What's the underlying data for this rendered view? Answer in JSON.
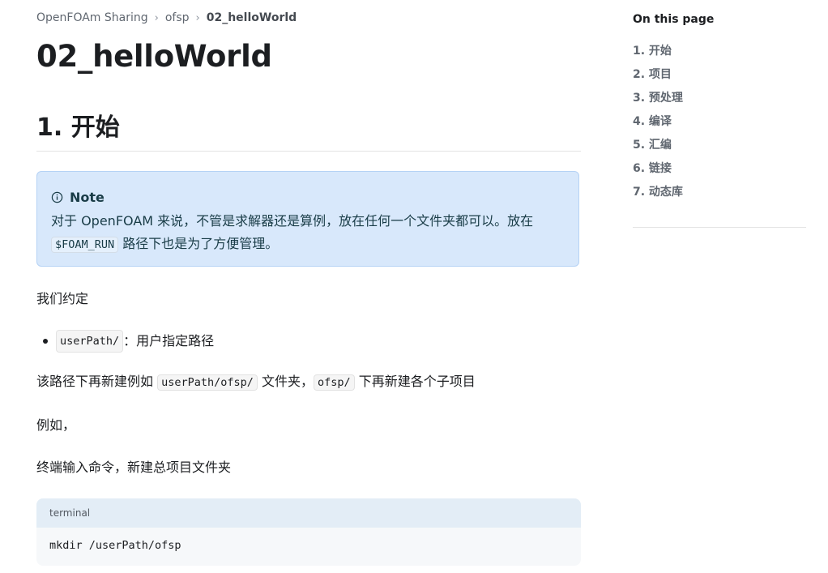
{
  "breadcrumbs": {
    "items": [
      "OpenFOAm Sharing",
      "ofsp"
    ],
    "current": "02_helloWorld"
  },
  "page": {
    "title": "02_helloWorld"
  },
  "section": {
    "heading": "1. 开始"
  },
  "note": {
    "label": "Note",
    "text_1": "对于 OpenFOAM 来说，不管是求解器还是算例，放在任何一个文件夹都可以。放在",
    "code": "$FOAM_RUN",
    "text_2": " 路径下也是为了方便管理。"
  },
  "content": {
    "convention": "我们约定",
    "bullet_code": "userPath/",
    "bullet_text": "：用户指定路径",
    "para2_a": "该路径下再新建例如 ",
    "para2_code1": "userPath/ofsp/",
    "para2_b": " 文件夹，",
    "para2_code2": "ofsp/",
    "para2_c": " 下再新建各个子项目",
    "example": "例如，",
    "terminal_instruction": "终端输入命令，新建总项目文件夹"
  },
  "codeblock": {
    "title": "terminal",
    "code": "mkdir /userPath/ofsp"
  },
  "toc": {
    "title": "On this page",
    "items": [
      "1. 开始",
      "2. 项目",
      "3. 预处理",
      "4. 编译",
      "5. 汇编",
      "6. 链接",
      "7. 动态库"
    ]
  },
  "colors": {
    "note_bg": "#d8e8fb",
    "note_border": "#b5d2f5",
    "note_text": "#193c47",
    "code_title_bg": "#e3edf6",
    "code_bg": "#f6f8fa"
  },
  "icons": {
    "breadcrumb_separator": "chevron-right-icon",
    "note": "info-icon"
  }
}
